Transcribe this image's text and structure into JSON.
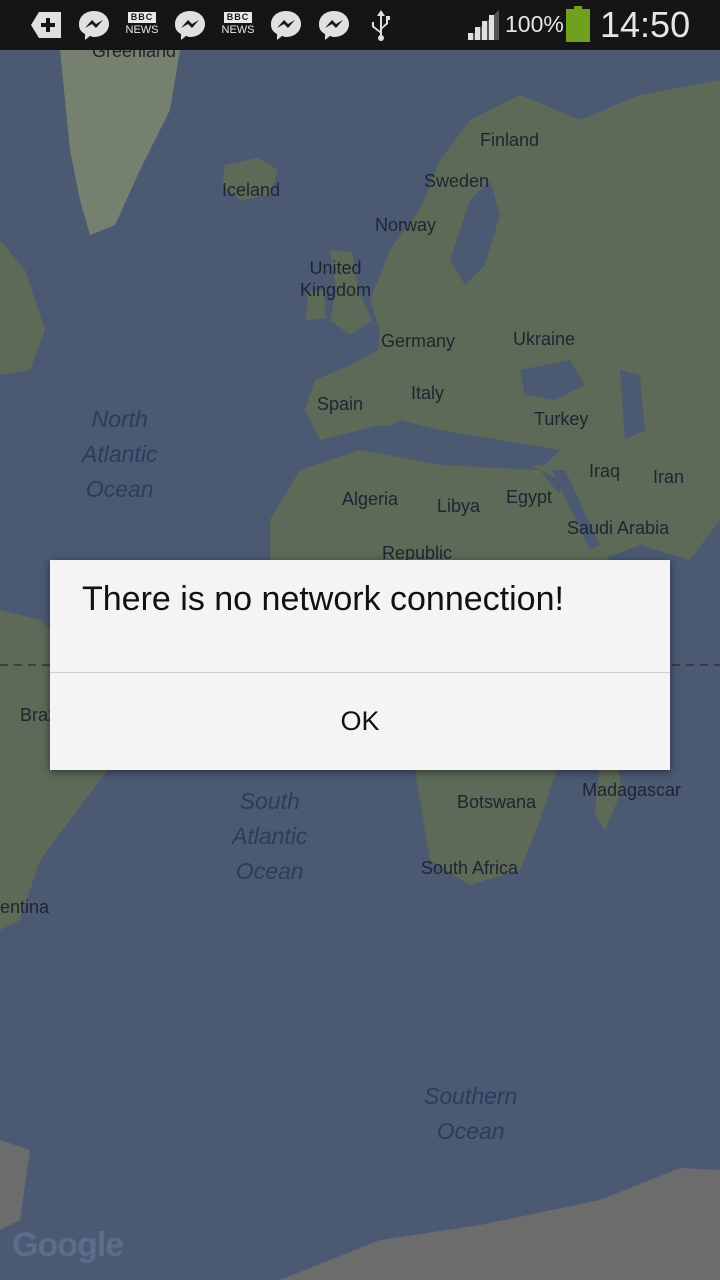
{
  "status_bar": {
    "notification_icons": [
      "add-icon",
      "messenger-icon",
      "bbc-news-icon",
      "messenger-icon",
      "bbc-news-icon",
      "messenger-icon",
      "messenger-icon",
      "usb-icon"
    ],
    "bbc_top": "BBC",
    "bbc_bottom": "NEWS",
    "battery_percent": "100%",
    "time": "14:50",
    "battery_color": "#6fa01e"
  },
  "map": {
    "country_labels": [
      {
        "id": "greenland",
        "text": "Greenland"
      },
      {
        "id": "finland",
        "text": "Finland"
      },
      {
        "id": "sweden",
        "text": "Sweden"
      },
      {
        "id": "iceland",
        "text": "Iceland"
      },
      {
        "id": "norway",
        "text": "Norway"
      },
      {
        "id": "uk",
        "text": "United\nKingdom"
      },
      {
        "id": "germany",
        "text": "Germany"
      },
      {
        "id": "ukraine",
        "text": "Ukraine"
      },
      {
        "id": "italy",
        "text": "Italy"
      },
      {
        "id": "spain",
        "text": "Spain"
      },
      {
        "id": "turkey",
        "text": "Turkey"
      },
      {
        "id": "iraq",
        "text": "Iraq"
      },
      {
        "id": "iran",
        "text": "Iran"
      },
      {
        "id": "algeria",
        "text": "Algeria"
      },
      {
        "id": "libya",
        "text": "Libya"
      },
      {
        "id": "egypt",
        "text": "Egypt"
      },
      {
        "id": "saudi-arabia",
        "text": "Saudi Arabia"
      },
      {
        "id": "republic",
        "text": "Republic"
      },
      {
        "id": "brazil",
        "text": "Braz"
      },
      {
        "id": "botswana",
        "text": "Botswana"
      },
      {
        "id": "madagascar",
        "text": "Madagascar"
      },
      {
        "id": "south-africa",
        "text": "South Africa"
      },
      {
        "id": "argentina",
        "text": "entina"
      }
    ],
    "ocean_labels": [
      {
        "id": "north-atlantic",
        "text": "North\nAtlantic\nOcean"
      },
      {
        "id": "south-atlantic",
        "text": "South\nAtlantic\nOcean"
      },
      {
        "id": "southern",
        "text": "Southern\nOcean"
      }
    ],
    "attribution": "Google",
    "water_color": "#4b5a72",
    "land_color": "#5d6a58"
  },
  "dialog": {
    "message": "There is no network connection!",
    "ok_label": "OK"
  }
}
